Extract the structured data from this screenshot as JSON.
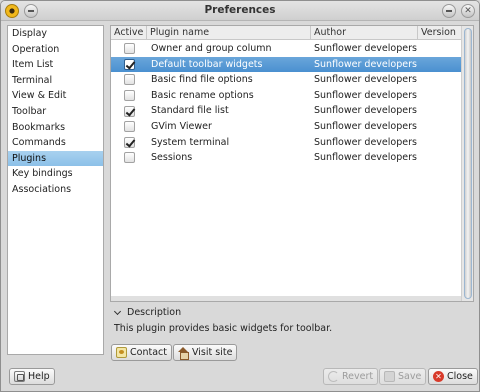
{
  "window": {
    "title": "Preferences"
  },
  "sidebar": {
    "items": [
      {
        "label": "Display"
      },
      {
        "label": "Operation"
      },
      {
        "label": "Item List"
      },
      {
        "label": "Terminal"
      },
      {
        "label": "View & Edit"
      },
      {
        "label": "Toolbar"
      },
      {
        "label": "Bookmarks"
      },
      {
        "label": "Commands"
      },
      {
        "label": "Plugins",
        "selected": true
      },
      {
        "label": "Key bindings"
      },
      {
        "label": "Associations"
      }
    ]
  },
  "plugins_table": {
    "columns": [
      "Active",
      "Plugin name",
      "Author",
      "Version"
    ],
    "rows": [
      {
        "active": false,
        "name": "Owner and group column",
        "author": "Sunflower developers",
        "version": ""
      },
      {
        "active": true,
        "name": "Default toolbar widgets",
        "author": "Sunflower developers",
        "version": "",
        "selected": true
      },
      {
        "active": false,
        "name": "Basic find file options",
        "author": "Sunflower developers",
        "version": ""
      },
      {
        "active": false,
        "name": "Basic rename options",
        "author": "Sunflower developers",
        "version": ""
      },
      {
        "active": true,
        "name": "Standard file list",
        "author": "Sunflower developers",
        "version": ""
      },
      {
        "active": false,
        "name": "GVim Viewer",
        "author": "Sunflower developers",
        "version": ""
      },
      {
        "active": true,
        "name": "System terminal",
        "author": "Sunflower developers",
        "version": ""
      },
      {
        "active": false,
        "name": "Sessions",
        "author": "Sunflower developers",
        "version": ""
      }
    ]
  },
  "description": {
    "heading": "Description",
    "text": "This plugin provides basic widgets for toolbar.",
    "contact_label": "Contact",
    "visit_site_label": "Visit site"
  },
  "footer": {
    "help_label": "Help",
    "revert_label": "Revert",
    "save_label": "Save",
    "close_label": "Close"
  },
  "icons": {
    "app": "sunflower-app-icon",
    "minimize": "minimize-icon",
    "close": "close-icon"
  }
}
